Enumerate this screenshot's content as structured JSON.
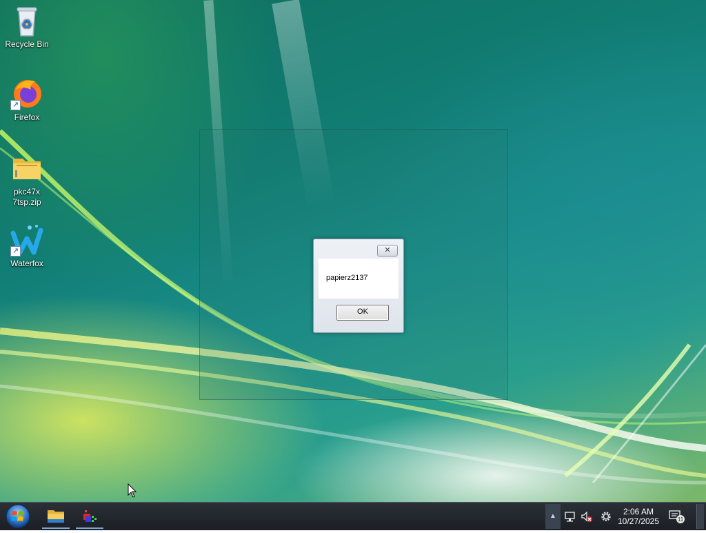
{
  "desktop": {
    "icons": [
      {
        "label": "Recycle Bin",
        "icon": "recycle-bin-icon"
      },
      {
        "label": "Firefox",
        "icon": "firefox-icon"
      },
      {
        "label": "pkc47x\n7tsp.zip",
        "icon": "zip-folder-icon"
      },
      {
        "label": "Waterfox",
        "icon": "waterfox-icon"
      }
    ]
  },
  "dialog": {
    "message": "papierz2137",
    "ok_label": "OK",
    "close_glyph": "✕"
  },
  "taskbar": {
    "pinned": [
      {
        "name": "File Explorer",
        "icon": "file-explorer-icon"
      },
      {
        "name": "App",
        "icon": "app-icon"
      }
    ],
    "tray": {
      "chevron": "▲",
      "time": "2:06 AM",
      "date": "10/27/2025",
      "notification_count": "11"
    }
  }
}
